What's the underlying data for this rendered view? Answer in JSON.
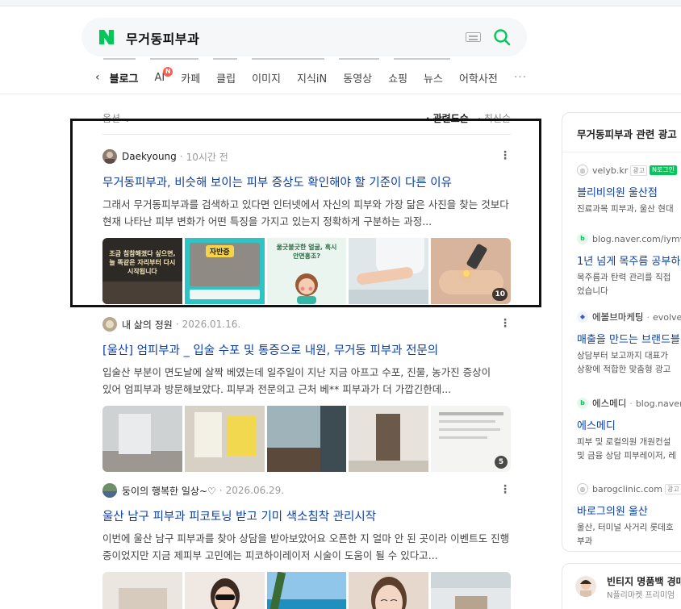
{
  "search": {
    "query": "무거동피부과"
  },
  "tabs": [
    {
      "label": "블로그",
      "active": true
    },
    {
      "label": "AI",
      "badge": "N"
    },
    {
      "label": "카페"
    },
    {
      "label": "클립"
    },
    {
      "label": "이미지"
    },
    {
      "label": "지식iN"
    },
    {
      "label": "동영상"
    },
    {
      "label": "쇼핑"
    },
    {
      "label": "뉴스"
    },
    {
      "label": "어학사전"
    }
  ],
  "tabs_more": "···",
  "options": {
    "left": "옵션",
    "sort_active": "· 관련도순",
    "sort_other": "· 최신순"
  },
  "posts": [
    {
      "author": "Daekyoung",
      "time": "10시간 전",
      "title": "무거동피부과, 비슷해 보이는 피부 증상도 확인해야 할 기준이 다른 이유",
      "desc": "그래서 무거동피부과를 검색하고 있다면 인터넷에서 자신의 피부와 가장 닮은 사진을 찾는 것보다 현재 나타난 피부 변화가 어떤 특징을 가지고 있는지 정확하게 구분하는 과정...",
      "image_count": "10",
      "thumb_texts": [
        "조금 침참해졌다 싶으면, 늘 똑같은 자리부터 다시 시작됩니다",
        "자반증",
        "울긋불긋한 얼굴, 혹시 안면홍조?"
      ]
    },
    {
      "author": "내 삶의 정원",
      "time": "2026.01.16.",
      "title": "[울산] 엄피부과 _ 입술 수포 및 통증으로 내원, 무거동 피부과 전문의",
      "desc": "입술산 부분이 면도날에 살짝 베였는데 일주일이 지난 지금 아프고 수포, 진물, 농가진 증상이 있어 엄피부과 방문해보았다. 피부과 전문의고 근처 베** 피부과가 더 가깝긴한데...",
      "image_count": "5"
    },
    {
      "author": "둥이의 행복한 일상~♡",
      "time": "2026.06.29.",
      "title": "울산 남구 피부과 피코토닝 받고 기미 색소침착 관리시작",
      "desc": "이번에 울산 남구 피부과를 찾아 상담을 받아보았어요 오픈한 지 얼마 안 된 곳이라 이벤트도 진행 중이었지만 지금 제피부 고민에는 피코하이레이저 시술이 도움이 될 수 있다고..."
    }
  ],
  "ads_panel": {
    "title": "무거동피부과 관련 광고",
    "ad_label": "광고",
    "ads": [
      {
        "source": "velyb.kr",
        "tag": "광고",
        "tag2": "N로그인",
        "title": "블리비의원 울산점",
        "desc": [
          "진료과목 피부과, 울산 현대"
        ]
      },
      {
        "source": "blog.naver.com/iymwy",
        "title": "1년 넘게 목주름 공부하",
        "desc": [
          "목주름과 탄력 관리를 직접",
          "었습니다"
        ]
      },
      {
        "source": "에볼브마케팅",
        "source_url": "evolver",
        "title": "매출을 만드는 브랜드블",
        "desc": [
          "상담부터 보고까지 대표가",
          "상황에 적합한 맞춤형 광고"
        ]
      },
      {
        "source": "에스메디",
        "source_url": "blog.naver.c",
        "title": "에스메디",
        "desc": [
          "피부 및 로컬의원 개원컨설",
          "및 금융 상담 피부레이저, 레"
        ]
      },
      {
        "source": "barogclinic.com",
        "tag": "광고",
        "title": "바로그의원 울산",
        "desc": [
          "울산, 터미널 사거리 롯데호",
          "부과"
        ]
      }
    ]
  },
  "promo_card": {
    "title": "빈티지 명품백 경매",
    "sub": "N플리마켓 프리미엄"
  },
  "colors": {
    "naver_green": "#03c75a",
    "link_blue": "#0c3fa8"
  }
}
